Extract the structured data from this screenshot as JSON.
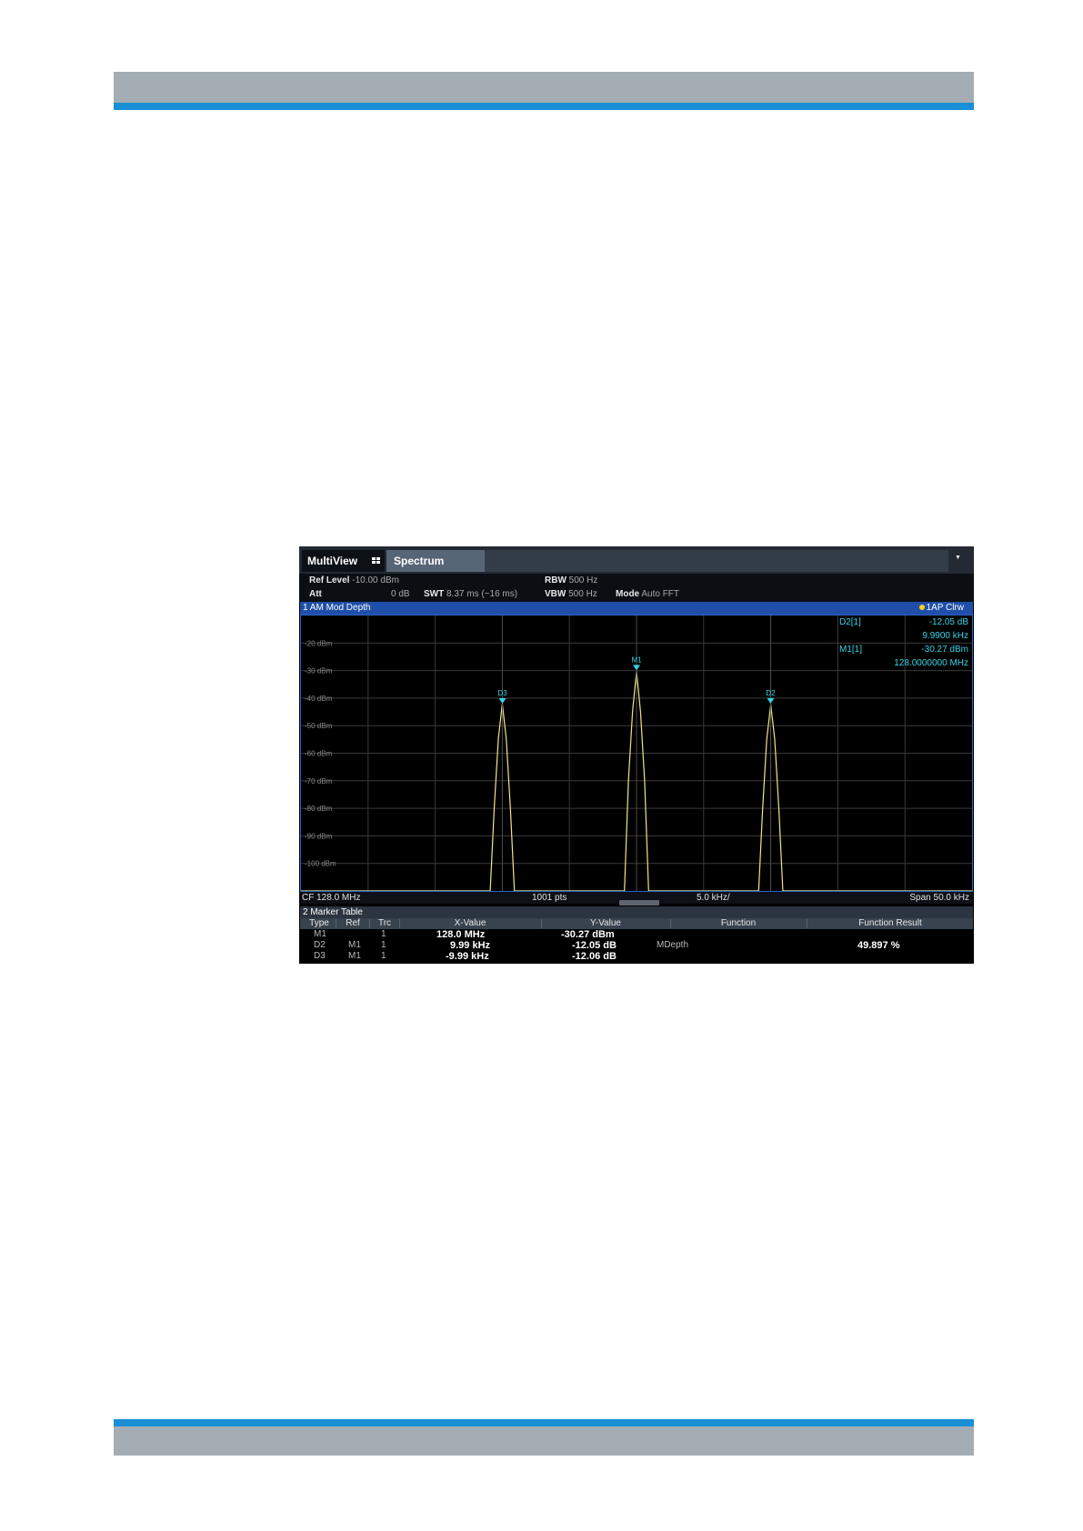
{
  "page": {
    "header_color": "#a3adb3",
    "stripe_color": "#1a8fd6"
  },
  "toolbar": {
    "multiview_label": "MultiView",
    "multiview_icon": "grid-icon",
    "spectrum_label": "Spectrum",
    "dropdown_icon": "dropdown-arrow-icon"
  },
  "settings": {
    "ref_level_label": "Ref Level",
    "ref_level_value": "-10.00 dBm",
    "att_label": "Att",
    "att_value": "0 dB",
    "swt_label": "SWT",
    "swt_value": "8.37 ms (~16 ms)",
    "rbw_label": "RBW",
    "rbw_value": "500 Hz",
    "vbw_label": "VBW",
    "vbw_value": "500 Hz",
    "mode_label": "Mode",
    "mode_value": "Auto FFT"
  },
  "window": {
    "title": "1 AM Mod Depth",
    "trace_badge": "1AP Clrw",
    "trace_dot_color": "#ffd21a"
  },
  "marker_info": [
    {
      "label": "D2[1]",
      "value": "-12.05 dB"
    },
    {
      "label": "",
      "value": "9.9900 kHz"
    },
    {
      "label": "M1[1]",
      "value": "-30.27 dBm"
    },
    {
      "label": "",
      "value": "128.0000000 MHz"
    }
  ],
  "chart_data": {
    "type": "line",
    "title": "1 AM Mod Depth",
    "x_unit": "kHz offset from CF",
    "xlim": [
      -25,
      25
    ],
    "ylim": [
      -110,
      -10
    ],
    "y_ticks": [
      {
        "value": -30,
        "label": "-30 dBm"
      },
      {
        "value": -20,
        "label": "-20 dBm"
      },
      {
        "value": -40,
        "label": "-40 dBm"
      },
      {
        "value": -50,
        "label": "-50 dBm"
      },
      {
        "value": -60,
        "label": "-60 dBm"
      },
      {
        "value": -70,
        "label": "-70 dBm"
      },
      {
        "value": -80,
        "label": "-80 dBm"
      },
      {
        "value": -90,
        "label": "-90 dBm"
      },
      {
        "value": -100,
        "label": "-100 dBm"
      }
    ],
    "grid": true,
    "trace_color": "#f0e68c",
    "series": [
      {
        "name": "1AP Clrw",
        "x": [
          -25,
          -10.9,
          -10.6,
          -10.3,
          -10,
          -9.7,
          -9.4,
          -9.1,
          -0.9,
          -0.6,
          -0.3,
          0,
          0.3,
          0.6,
          0.9,
          9.1,
          9.4,
          9.7,
          10,
          10.3,
          10.6,
          10.9,
          25
        ],
        "y": [
          -110,
          -110,
          -80,
          -55,
          -42,
          -55,
          -80,
          -110,
          -110,
          -70,
          -45,
          -30.27,
          -45,
          -70,
          -110,
          -110,
          -80,
          -55,
          -42.3,
          -55,
          -80,
          -110,
          -110
        ]
      }
    ],
    "markers": [
      {
        "name": "M1",
        "x": 0,
        "y": -30.27
      },
      {
        "name": "D2",
        "x": 9.99,
        "y": -42.32
      },
      {
        "name": "D3",
        "x": -9.99,
        "y": -42.33
      }
    ],
    "footer": {
      "cf": "CF 128.0 MHz",
      "points": "1001 pts",
      "div": "5.0 kHz/",
      "span": "Span 50.0 kHz"
    }
  },
  "marker_table": {
    "title": "2 Marker Table",
    "headers": [
      "Type",
      "Ref",
      "Trc",
      "X-Value",
      "Y-Value",
      "Function",
      "Function Result"
    ],
    "rows": [
      {
        "type": "M1",
        "ref": "",
        "trc": "1",
        "x": "128.0 MHz",
        "y": "-30.27 dBm"
      },
      {
        "type": "D2",
        "ref": "M1",
        "trc": "1",
        "x": "9.99 kHz",
        "y": "-12.05 dB"
      },
      {
        "type": "D3",
        "ref": "M1",
        "trc": "1",
        "x": "-9.99 kHz",
        "y": "-12.06 dB"
      }
    ],
    "function": "MDepth",
    "function_result": "49.897 %"
  }
}
